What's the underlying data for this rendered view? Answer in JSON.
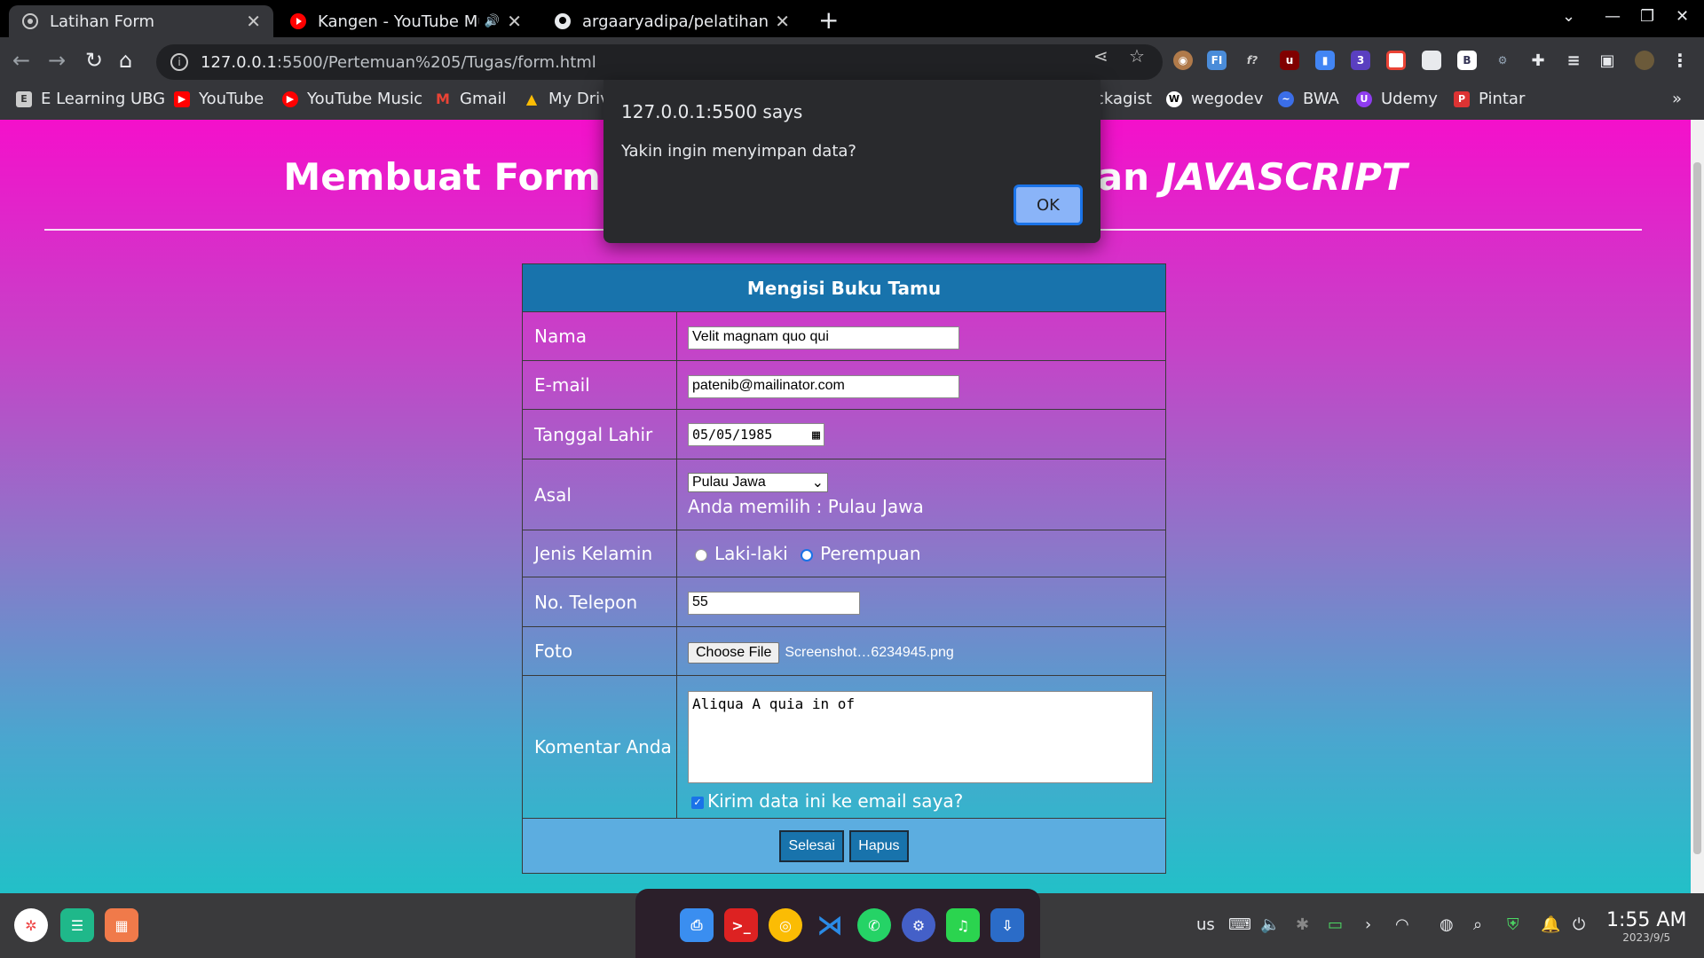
{
  "browser": {
    "tabs": [
      {
        "title": "Latihan Form",
        "active": true
      },
      {
        "title": "Kangen - YouTube Music",
        "active": false
      },
      {
        "title": "argaaryadipa/pelatihanAn",
        "active": false
      }
    ],
    "url_host": "127.0.0.1",
    "url_rest": ":5500/Pertemuan%205/Tugas/form.html",
    "bookmarks": [
      "E Learning UBG",
      "YouTube",
      "YouTube Music",
      "Gmail",
      "My Drive",
      "ckagist",
      "wegodev",
      "BWA",
      "Udemy",
      "Pintar"
    ]
  },
  "page": {
    "heading_start": "Membuat Form",
    "heading_mid": "an",
    "heading_italic": "JAVASCRIPT",
    "form": {
      "title": "Mengisi Buku Tamu",
      "nama_label": "Nama",
      "nama_value": "Velit magnam quo qui",
      "email_label": "E-mail",
      "email_value": "patenib@mailinator.com",
      "tgl_label": "Tanggal Lahir",
      "tgl_value": "05/05/1985",
      "asal_label": "Asal",
      "asal_value": "Pulau Jawa",
      "asal_note": "Anda memilih : Pulau Jawa",
      "jk_label": "Jenis Kelamin",
      "jk_opt1": "Laki-laki",
      "jk_opt2": "Perempuan",
      "tel_label": "No. Telepon",
      "tel_value": "55",
      "foto_label": "Foto",
      "foto_button": "Choose File",
      "foto_file": "Screenshot…6234945.png",
      "komentar_label": "Komentar Anda",
      "komentar_value": "Aliqua A quia in of",
      "kirim_label": "Kirim data ini ke email saya?",
      "submit": "Selesai",
      "reset": "Hapus"
    }
  },
  "dialog": {
    "origin": "127.0.0.1:5500 says",
    "message": "Yakin ingin menyimpan data?",
    "ok": "OK"
  },
  "system": {
    "keyboard": "us",
    "time": "1:55 AM",
    "date": "2023/9/5"
  }
}
